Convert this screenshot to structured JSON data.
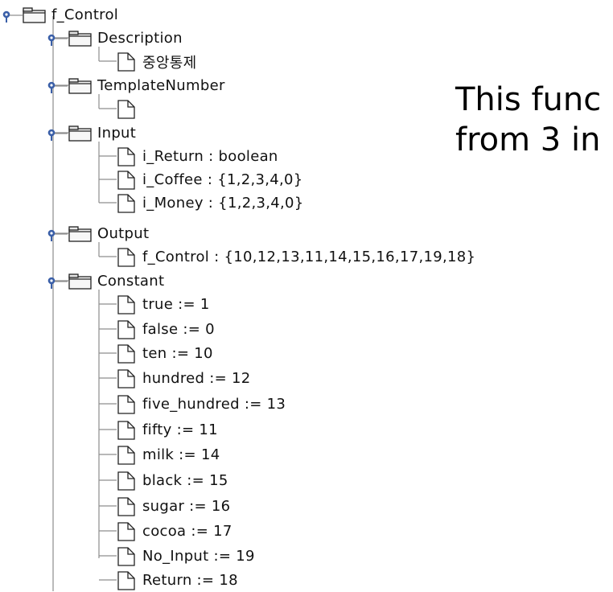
{
  "tree": {
    "root": {
      "label": "f_Control",
      "handle_icon": "key-handle-icon",
      "icon": "folder-icon"
    },
    "groups": [
      {
        "label": "Description",
        "children": [
          "중앙통제"
        ]
      },
      {
        "label": "TemplateNumber",
        "children": [
          ""
        ]
      },
      {
        "label": "Input",
        "children": [
          "i_Return : boolean",
          "i_Coffee : {1,2,3,4,0}",
          "i_Money : {1,2,3,4,0}"
        ]
      },
      {
        "label": "Output",
        "children": [
          "f_Control : {10,12,13,11,14,15,16,17,19,18}"
        ]
      },
      {
        "label": "Constant",
        "children": [
          "true := 1",
          "false := 0",
          "ten := 10",
          "hundred := 12",
          "five_hundred := 13",
          "fifty := 11",
          "milk := 14",
          "black := 15",
          "sugar := 16",
          "cocoa := 17",
          "No_Input := 19",
          "Return := 18"
        ]
      }
    ]
  },
  "overlay": {
    "line1": "This func",
    "line2": "from 3 in"
  },
  "colors": {
    "handle": "#3a5fa8",
    "tree_line": "#8d8d8d",
    "folder_fill": "#f7f7f7",
    "folder_tab": "#e6e6e6",
    "outline": "#222222",
    "text": "#111111"
  }
}
